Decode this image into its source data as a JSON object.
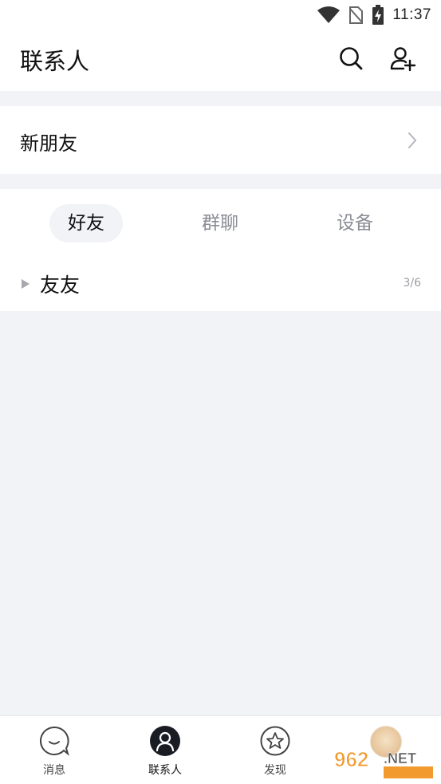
{
  "status_bar": {
    "time": "11:37",
    "icons": [
      "wifi-icon",
      "no-sim-icon",
      "battery-charging-icon"
    ]
  },
  "header": {
    "title": "联系人",
    "actions": [
      "search-icon",
      "add-contact-icon"
    ]
  },
  "new_friends": {
    "label": "新朋友"
  },
  "tabs": [
    {
      "label": "好友",
      "active": true
    },
    {
      "label": "群聊",
      "active": false
    },
    {
      "label": "设备",
      "active": false
    }
  ],
  "groups": [
    {
      "name": "友友",
      "count": "3/6",
      "expanded": false
    }
  ],
  "bottom_nav": [
    {
      "label": "消息",
      "icon": "chat-bubble-icon",
      "active": false
    },
    {
      "label": "联系人",
      "icon": "person-icon",
      "active": true
    },
    {
      "label": "发现",
      "icon": "star-icon",
      "active": false
    },
    {
      "label": "",
      "icon": "avatar",
      "active": false
    }
  ],
  "colors": {
    "background": "#f2f3f7",
    "active_nav": "#1a1c24",
    "muted_text": "#8a8d94"
  }
}
